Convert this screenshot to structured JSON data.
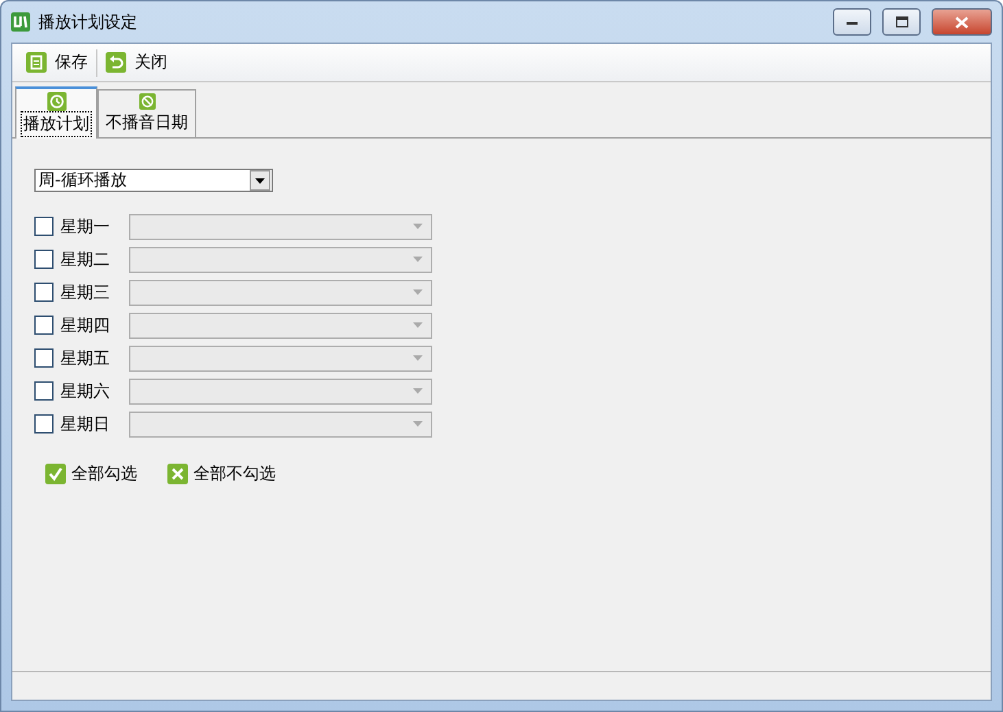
{
  "window": {
    "title": "播放计划设定"
  },
  "toolbar": [
    {
      "label": "保存",
      "kind": "save"
    },
    {
      "label": "关闭",
      "kind": "close"
    }
  ],
  "tabs": [
    {
      "label": "播放计划",
      "kind": "clock",
      "selected": true
    },
    {
      "label": "不播音日期",
      "kind": "forbid",
      "selected": false
    }
  ],
  "mode_select": {
    "value": "周-循环播放"
  },
  "days": [
    {
      "label": "星期一",
      "checked": false
    },
    {
      "label": "星期二",
      "checked": false
    },
    {
      "label": "星期三",
      "checked": false
    },
    {
      "label": "星期四",
      "checked": false
    },
    {
      "label": "星期五",
      "checked": false
    },
    {
      "label": "星期六",
      "checked": false
    },
    {
      "label": "星期日",
      "checked": false
    }
  ],
  "actions": [
    {
      "label": "全部勾选",
      "kind": "check"
    },
    {
      "label": "全部不勾选",
      "kind": "uncheck"
    }
  ]
}
